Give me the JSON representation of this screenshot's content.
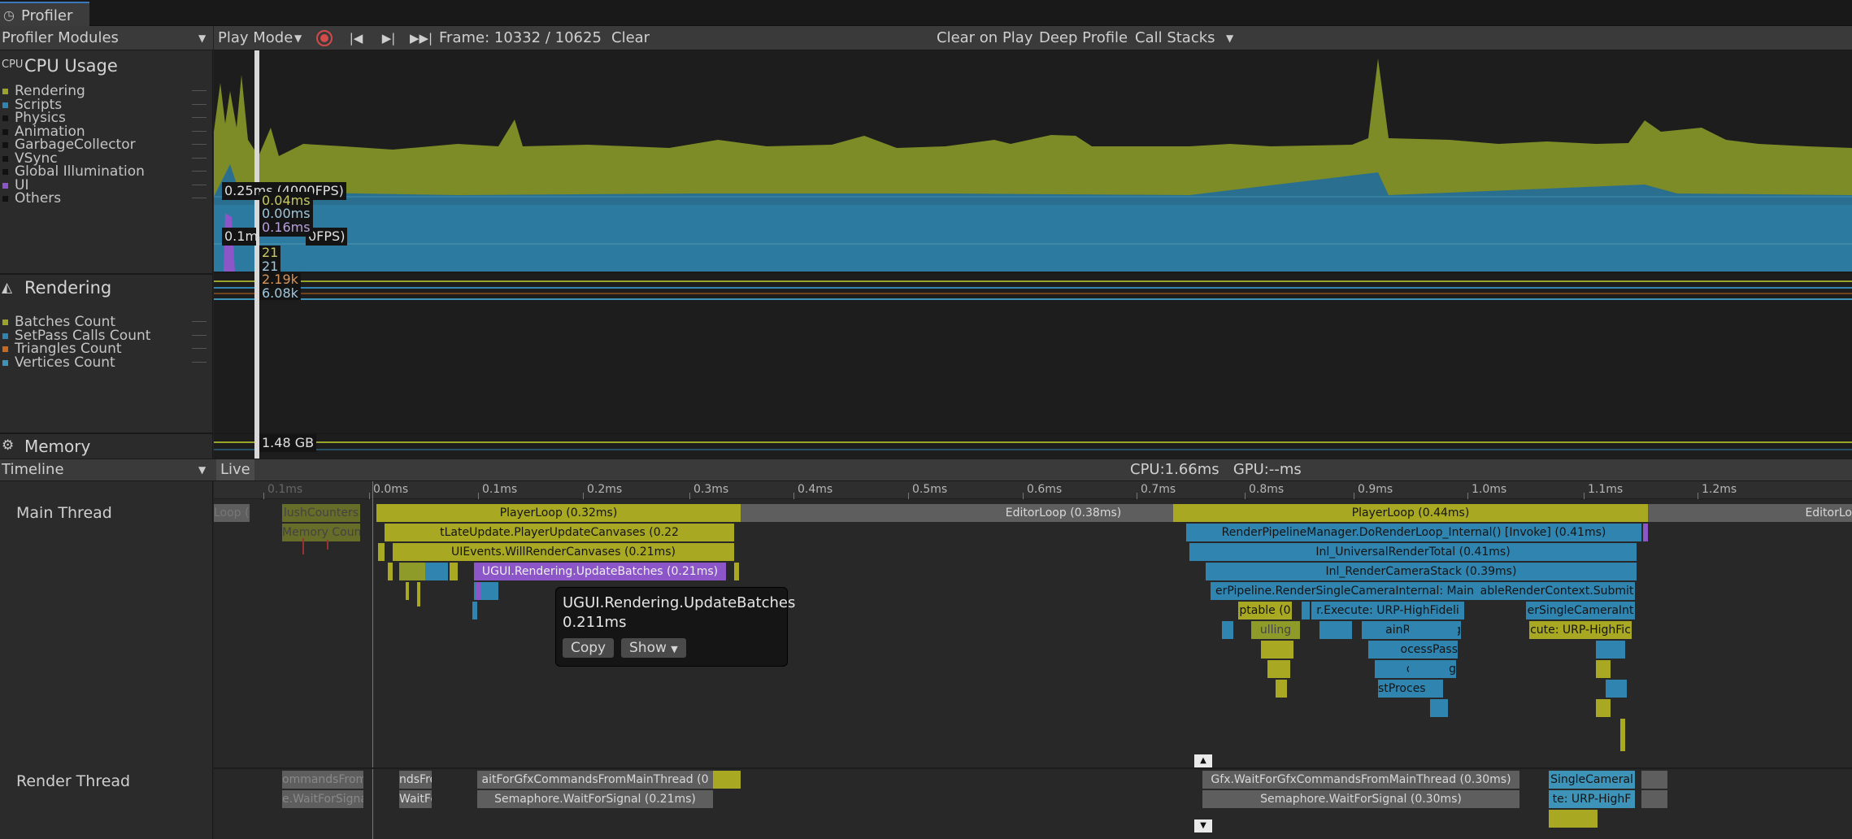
{
  "window": {
    "tab_title": "Profiler"
  },
  "toolbar": {
    "modules": "Profiler Modules",
    "play_mode": "Play Mode",
    "frame": "Frame: 10332 / 10625",
    "clear": "Clear",
    "clear_on_play": "Clear on Play",
    "deep_profile": "Deep Profile",
    "call_stacks": "Call Stacks"
  },
  "cpu_module": {
    "title": "CPU Usage",
    "legend": [
      {
        "label": "Rendering",
        "color": "#9aa32a"
      },
      {
        "label": "Scripts",
        "color": "#2f84b0"
      },
      {
        "label": "Physics",
        "color": "#111111"
      },
      {
        "label": "Animation",
        "color": "#111111"
      },
      {
        "label": "GarbageCollector",
        "color": "#111111"
      },
      {
        "label": "VSync",
        "color": "#111111"
      },
      {
        "label": "Global Illumination",
        "color": "#111111"
      },
      {
        "label": "UI",
        "color": "#8c55c8"
      },
      {
        "label": "Others",
        "color": "#111111"
      }
    ],
    "line1": "0.25ms (4000FPS)",
    "line2_prefix": "0.1m",
    "line2_suffix": "0FPS)",
    "values": [
      "0.04ms",
      "0.00ms",
      "0.16ms"
    ]
  },
  "rendering_module": {
    "title": "Rendering",
    "legend": [
      {
        "label": "Batches Count",
        "color": "#9aa32a"
      },
      {
        "label": "SetPass Calls Count",
        "color": "#2f84b0"
      },
      {
        "label": "Triangles Count",
        "color": "#c76a1f"
      },
      {
        "label": "Vertices Count",
        "color": "#3d93b8"
      }
    ],
    "values": [
      "21",
      "21",
      "2.19k",
      "6.08k"
    ]
  },
  "memory_module": {
    "title": "Memory",
    "value": "1.48 GB"
  },
  "timeline_bar": {
    "view": "Timeline",
    "live": "Live",
    "stats": "CPU:1.66ms   GPU:--ms"
  },
  "ruler": [
    "0.1ms",
    "0.0ms",
    "0.1ms",
    "0.2ms",
    "0.3ms",
    "0.4ms",
    "0.5ms",
    "0.6ms",
    "0.7ms",
    "0.8ms",
    "0.9ms",
    "1.0ms",
    "1.1ms",
    "1.2ms"
  ],
  "threads": {
    "main": "Main Thread",
    "render": "Render Thread"
  },
  "main_bars": {
    "loop_left": "Loop (0.1",
    "flush": "lushCounters",
    "memcount": "Memory Coun",
    "player_loop_1": "PlayerLoop (0.32ms)",
    "editor_loop": "EditorLoop (0.38ms)",
    "player_loop_2": "PlayerLoop (0.44ms)",
    "editor_loop_right": "EditorLo",
    "late_update": "tLateUpdate.PlayerUpdateCanvases (0.22",
    "ui_events": "UIEvents.WillRenderCanvases (0.21ms)",
    "update_batches": "UGUI.Rendering.UpdateBatches (0.21ms)",
    "render_pipeline": "RenderPipelineManager.DoRenderLoop_Internal() [Invoke] (0.41ms)",
    "urp_total": "Inl_UniversalRenderTotal (0.41ms)",
    "camera_stack": "Inl_RenderCameraStack (0.39ms)",
    "single_cam": "erPipeline.RenderSingleCameraInternal: Main",
    "submit": "ableRenderContext.Submit",
    "ptable": "ptable (0",
    "execute": "r.Execute: URP-HighFideli",
    "single_cam2": "erSingleCameraInt",
    "culling": "ulling",
    "main_rendering": "ainRendering",
    "execute2": "cute: URP-HighFic",
    "process_pass": "ocessPass",
    "processing": "ocessing",
    "post_process": "stProces"
  },
  "render_bars": {
    "cmds_from": "ommandsFromMa",
    "wait_for_signal": "e.WaitForSignal",
    "nds_from": "ndsFron",
    "wait_for": "WaitFor",
    "gfx_wait_1": "aitForGfxCommandsFromMainThread (0",
    "sem_1": "Semaphore.WaitForSignal (0.21ms)",
    "gfx_wait_2": "Gfx.WaitForGfxCommandsFromMainThread (0.30ms)",
    "sem_2": "Semaphore.WaitForSignal (0.30ms)",
    "single_cam_r": "SingleCameral",
    "urp_high": "te: URP-HighF"
  },
  "tooltip": {
    "name": "UGUI.Rendering.UpdateBatches",
    "time": "0.211ms",
    "copy": "Copy",
    "show": "Show"
  }
}
